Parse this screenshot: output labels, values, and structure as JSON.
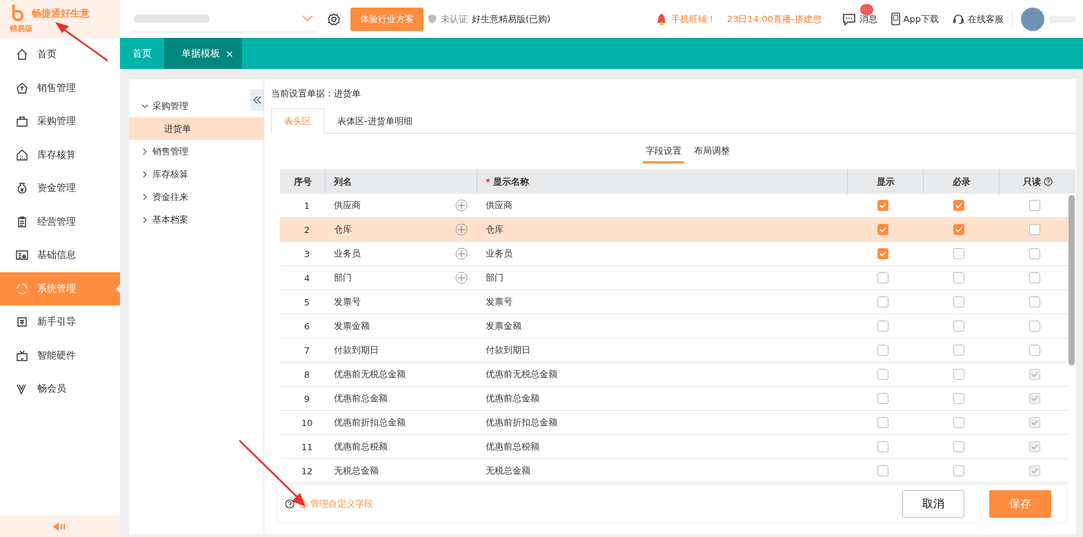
{
  "brand": {
    "name": "畅捷通好生意",
    "edition": "精易版"
  },
  "header": {
    "trial_button": "体验行业方案",
    "cert": "未认证",
    "plan": "好生意精易版(已购)",
    "notices": [
      "手机旺铺！",
      "23日14:00直播-搭建您"
    ],
    "messages": {
      "label": "消息",
      "badge": "···"
    },
    "app_download": "App下载",
    "service": "在线客服"
  },
  "sidebar": {
    "items": [
      {
        "label": "首页",
        "selected": false
      },
      {
        "label": "销售管理",
        "selected": false
      },
      {
        "label": "采购管理",
        "selected": false
      },
      {
        "label": "库存核算",
        "selected": false
      },
      {
        "label": "资金管理",
        "selected": false
      },
      {
        "label": "经营管理",
        "selected": false
      },
      {
        "label": "基础信息",
        "selected": false
      },
      {
        "label": "系统管理",
        "selected": true
      },
      {
        "label": "新手引导",
        "selected": false
      },
      {
        "label": "智能硬件",
        "selected": false
      },
      {
        "label": "畅会员",
        "selected": false
      }
    ]
  },
  "page_tabs": [
    {
      "label": "首页",
      "selected": false,
      "closable": false
    },
    {
      "label": "单据模板",
      "selected": true,
      "closable": true,
      "close": "×"
    }
  ],
  "tree": [
    {
      "label": "采购管理",
      "expanded": true,
      "children": [
        {
          "label": "进货单",
          "selected": true
        }
      ]
    },
    {
      "label": "销售管理",
      "expanded": false
    },
    {
      "label": "库存核算",
      "expanded": false
    },
    {
      "label": "资金往来",
      "expanded": false
    },
    {
      "label": "基本档案",
      "expanded": false
    }
  ],
  "current_doc": "当前设置单据：进货单",
  "section_tabs": [
    {
      "label": "表头区",
      "selected": true
    },
    {
      "label": "表体区-进货单明细",
      "selected": false
    }
  ],
  "sub_tabs": [
    {
      "label": "字段设置",
      "selected": true
    },
    {
      "label": "布局调整",
      "selected": false
    }
  ],
  "table": {
    "columns": [
      {
        "label": "序号"
      },
      {
        "label": "列名"
      },
      {
        "label": "显示名称",
        "mark": "*"
      },
      {
        "label": "显示"
      },
      {
        "label": "必录"
      },
      {
        "label": "只读",
        "help": true
      }
    ],
    "rows": [
      {
        "no": "1",
        "name": "供应商",
        "addable": true,
        "display": "供应商",
        "selected": false,
        "show": {
          "checked": true,
          "disabled": false
        },
        "must": {
          "checked": true,
          "disabled": false
        },
        "readonly": {
          "checked": false,
          "disabled": false
        }
      },
      {
        "no": "2",
        "name": "仓库",
        "addable": true,
        "display": "仓库",
        "selected": true,
        "show": {
          "checked": true,
          "disabled": false
        },
        "must": {
          "checked": true,
          "disabled": false
        },
        "readonly": {
          "checked": false,
          "disabled": false
        }
      },
      {
        "no": "3",
        "name": "业务员",
        "addable": true,
        "display": "业务员",
        "selected": false,
        "show": {
          "checked": true,
          "disabled": false
        },
        "must": {
          "checked": false,
          "disabled": false
        },
        "readonly": {
          "checked": false,
          "disabled": false
        }
      },
      {
        "no": "4",
        "name": "部门",
        "addable": true,
        "display": "部门",
        "selected": false,
        "show": {
          "checked": false,
          "disabled": false
        },
        "must": {
          "checked": false,
          "disabled": false
        },
        "readonly": {
          "checked": false,
          "disabled": false
        }
      },
      {
        "no": "5",
        "name": "发票号",
        "addable": false,
        "display": "发票号",
        "selected": false,
        "show": {
          "checked": false,
          "disabled": false
        },
        "must": {
          "checked": false,
          "disabled": false
        },
        "readonly": {
          "checked": false,
          "disabled": false
        }
      },
      {
        "no": "6",
        "name": "发票金额",
        "addable": false,
        "display": "发票金额",
        "selected": false,
        "show": {
          "checked": false,
          "disabled": false
        },
        "must": {
          "checked": false,
          "disabled": false
        },
        "readonly": {
          "checked": false,
          "disabled": false
        }
      },
      {
        "no": "7",
        "name": "付款到期日",
        "addable": false,
        "display": "付款到期日",
        "selected": false,
        "show": {
          "checked": false,
          "disabled": false
        },
        "must": {
          "checked": false,
          "disabled": false
        },
        "readonly": {
          "checked": false,
          "disabled": false
        }
      },
      {
        "no": "8",
        "name": "优惠前无税总金额",
        "addable": false,
        "display": "优惠前无税总金额",
        "selected": false,
        "show": {
          "checked": false,
          "disabled": false
        },
        "must": {
          "checked": false,
          "disabled": false
        },
        "readonly": {
          "checked": true,
          "disabled": true
        }
      },
      {
        "no": "9",
        "name": "优惠前总金额",
        "addable": false,
        "display": "优惠前总金额",
        "selected": false,
        "show": {
          "checked": false,
          "disabled": false
        },
        "must": {
          "checked": false,
          "disabled": false
        },
        "readonly": {
          "checked": true,
          "disabled": true
        }
      },
      {
        "no": "10",
        "name": "优惠前折扣总金额",
        "addable": false,
        "display": "优惠前折扣总金额",
        "selected": false,
        "show": {
          "checked": false,
          "disabled": false
        },
        "must": {
          "checked": false,
          "disabled": false
        },
        "readonly": {
          "checked": true,
          "disabled": true
        }
      },
      {
        "no": "11",
        "name": "优惠前总税额",
        "addable": false,
        "display": "优惠前总税额",
        "selected": false,
        "show": {
          "checked": false,
          "disabled": false
        },
        "must": {
          "checked": false,
          "disabled": false
        },
        "readonly": {
          "checked": true,
          "disabled": true
        }
      },
      {
        "no": "12",
        "name": "无税总金额",
        "addable": false,
        "display": "无税总金额",
        "selected": false,
        "show": {
          "checked": false,
          "disabled": false
        },
        "must": {
          "checked": false,
          "disabled": false
        },
        "readonly": {
          "checked": true,
          "disabled": true
        }
      }
    ]
  },
  "footer": {
    "manage_link": "管理自定义字段",
    "cancel": "取消",
    "save": "保存"
  }
}
